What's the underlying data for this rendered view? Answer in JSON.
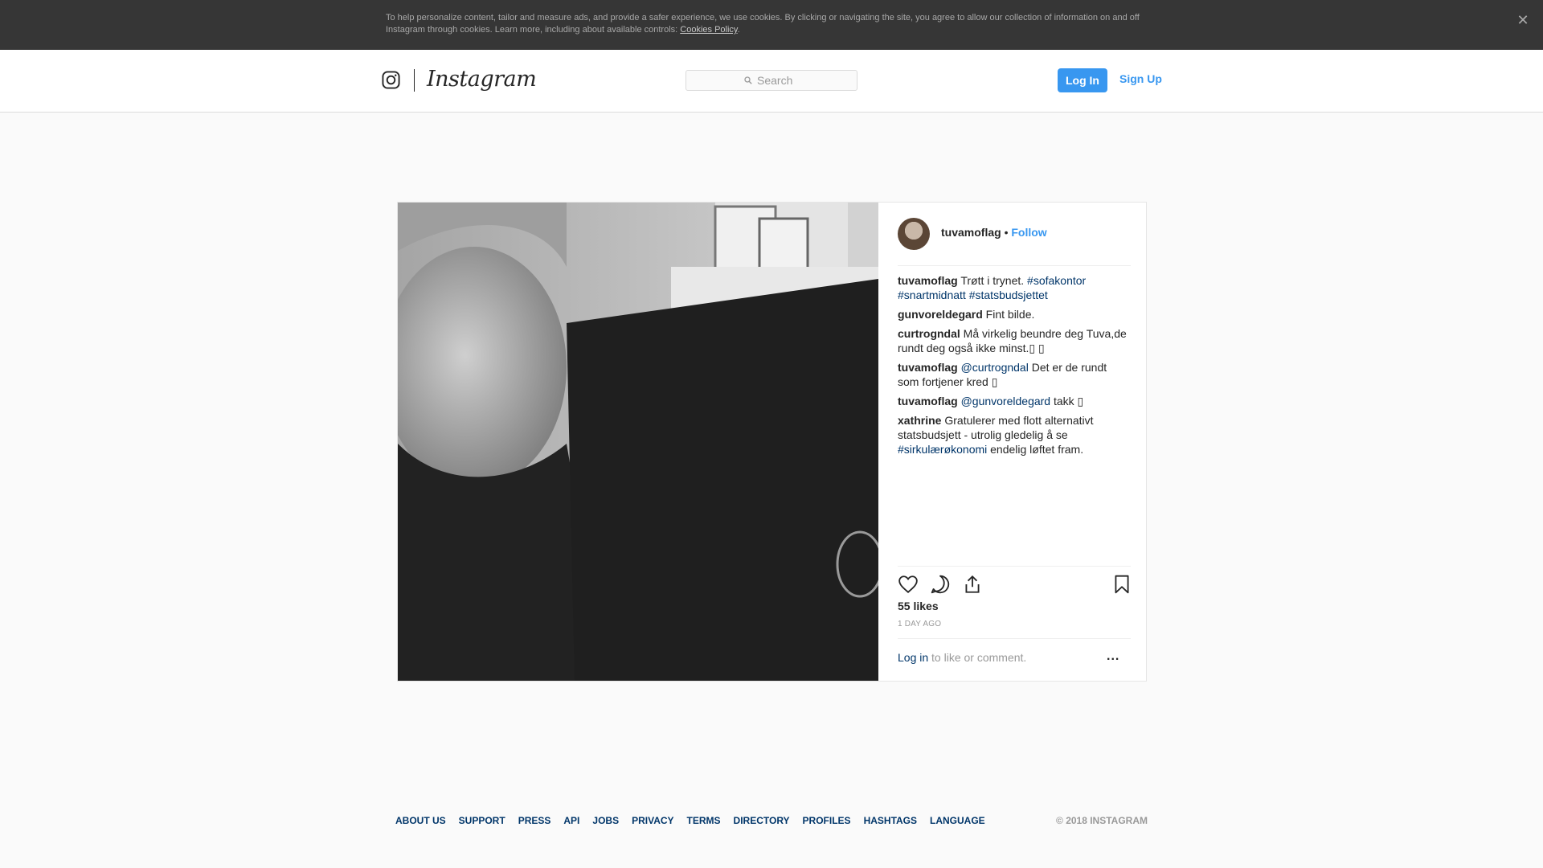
{
  "cookie_banner": {
    "text": "To help personalize content, tailor and measure ads, and provide a safer experience, we use cookies. By clicking or navigating the site, you agree to allow our collection of information on and off Instagram through cookies. Learn more, including about available controls: ",
    "link": "Cookies Policy",
    "suffix": ".",
    "close_icon": "close-icon"
  },
  "header": {
    "wordmark": "Instagram",
    "search_placeholder": "Search",
    "login_label": "Log In",
    "signup_label": "Sign Up"
  },
  "post": {
    "author": "tuvamoflag",
    "dot": "•",
    "follow_label": "Follow",
    "comments": [
      {
        "user": "tuvamoflag",
        "parts": [
          {
            "t": " Trøtt i trynet. "
          },
          {
            "link": "#sofakontor"
          },
          {
            "t": " "
          },
          {
            "link": "#snartmidnatt"
          },
          {
            "t": " "
          },
          {
            "link": "#statsbudsjettet"
          }
        ]
      },
      {
        "user": "gunvoreldegard",
        "parts": [
          {
            "t": " Fint bilde."
          }
        ]
      },
      {
        "user": "curtrogndal",
        "parts": [
          {
            "t": " Må virkelig beundre deg Tuva,de rundt deg også ikke minst.▯ ▯"
          }
        ]
      },
      {
        "user": "tuvamoflag",
        "parts": [
          {
            "t": " "
          },
          {
            "link": "@curtrogndal"
          },
          {
            "t": " Det er de rundt som fortjener kred ▯"
          }
        ]
      },
      {
        "user": "tuvamoflag",
        "parts": [
          {
            "t": " "
          },
          {
            "link": "@gunvoreldegard"
          },
          {
            "t": " takk ▯"
          }
        ]
      },
      {
        "user": "xathrine",
        "parts": [
          {
            "t": " Gratulerer med flott alternativt statsbudsjett - utrolig gledelig å se "
          },
          {
            "link": "#sirkulærøkonomi"
          },
          {
            "t": " endelig løftet fram."
          }
        ]
      }
    ],
    "likes": "55 likes",
    "time_ago": "1 DAY AGO",
    "login_link": "Log in",
    "login_suffix": " to like or comment.",
    "more_label": "..."
  },
  "footer": {
    "links": [
      "ABOUT US",
      "SUPPORT",
      "PRESS",
      "API",
      "JOBS",
      "PRIVACY",
      "TERMS",
      "DIRECTORY",
      "PROFILES",
      "HASHTAGS",
      "LANGUAGE"
    ],
    "copyright": "© 2018 INSTAGRAM"
  },
  "colors": {
    "accent": "#3897f0",
    "link": "#003569",
    "banner_bg": "#363636"
  }
}
